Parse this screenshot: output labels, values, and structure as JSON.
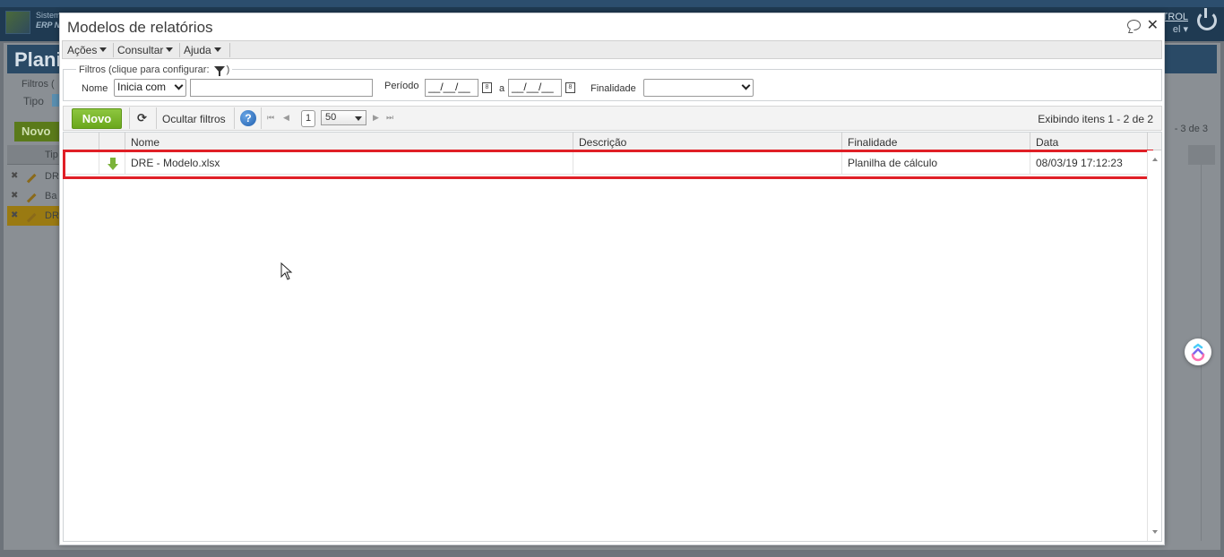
{
  "background": {
    "system_lines": [
      "Sistem",
      "ERP N"
    ],
    "user_lines": [
      "TROL",
      "el"
    ],
    "page_title": "Plani",
    "filters_label": "Filtros (",
    "tipo_label": "Tipo",
    "novo_label": "Novo",
    "count_text": "- 3 de 3",
    "grid_header": "Tip",
    "rows": [
      "DR",
      "Ba",
      "DR"
    ]
  },
  "modal": {
    "title": "Modelos de relatórios",
    "menu": [
      {
        "label": "Ações"
      },
      {
        "label": "Consultar"
      },
      {
        "label": "Ajuda"
      }
    ],
    "filters": {
      "legend": "Filtros (clique para configurar:",
      "legend_close": ")",
      "nome_label": "Nome",
      "nome_operator": "Inicia com",
      "nome_value": "",
      "periodo_label": "Período",
      "date_from": "__/__/__",
      "date_to": "__/__/__",
      "a_label": "a",
      "finalidade_label": "Finalidade",
      "finalidade_value": ""
    },
    "toolbar": {
      "novo_label": "Novo",
      "refresh_glyph": "⟳",
      "hide_filters_label": "Ocultar filtros",
      "help_glyph": "?",
      "first_glyph": "⏮",
      "prev_glyph": "◀",
      "next_glyph": "▶",
      "last_glyph": "⏭",
      "page": "1",
      "page_size": "50",
      "count_text": "Exibindo itens 1 - 2 de 2"
    },
    "grid": {
      "columns": [
        "Nome",
        "Descrição",
        "Finalidade",
        "Data"
      ],
      "rows": [
        {
          "nome": "DRE - Modelo.xlsx",
          "descricao": "",
          "finalidade": "Planilha de cálculo",
          "data": "08/03/19 17:12:23"
        }
      ]
    }
  },
  "icons": {
    "comment": "comment-icon",
    "close": "close-icon",
    "funnel": "funnel-icon",
    "refresh": "refresh-icon",
    "help": "help-icon",
    "download": "download-icon",
    "calendar": "calendar-icon",
    "cursor": "cursor-icon",
    "widget": "widget-icon"
  },
  "colors": {
    "accent_green": "#7bb33a",
    "highlight_red": "#e01f26",
    "help_blue": "#1f5fae"
  }
}
